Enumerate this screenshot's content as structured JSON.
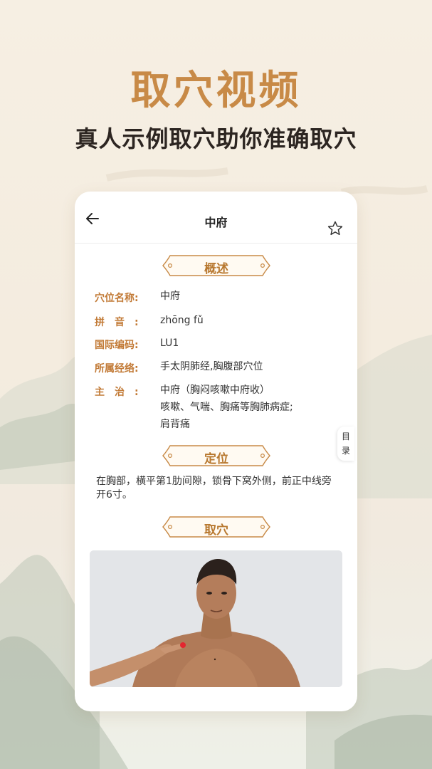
{
  "promo": {
    "title": "取穴视频",
    "subtitle": "真人示例取穴助你准确取穴"
  },
  "header": {
    "title": "中府",
    "back_icon": "arrow-left-icon",
    "favorite_icon": "star-outline-icon"
  },
  "sections": {
    "overview": "概述",
    "location": "定位",
    "acupoint": "取穴"
  },
  "overview": {
    "name_label": "穴位名称:",
    "name_value": "中府",
    "pinyin_label": "拼音:",
    "pinyin_value": "zhōng fǔ",
    "code_label": "国际编码:",
    "code_value": "LU1",
    "meridian_label": "所属经络:",
    "meridian_value": "手太阴肺经,胸腹部穴位",
    "indication_label": "主治:",
    "indication_lines": [
      "中府（胸闷咳嗽中府收）",
      "咳嗽、气喘、胸痛等胸肺病症;",
      "肩背痛"
    ]
  },
  "location_text": "在胸部，横平第1肋间隙，锁骨下窝外侧，前正中线旁开6寸。",
  "catalog_tab": "目录",
  "colors": {
    "accent": "#c88a47",
    "label": "#c27a36",
    "marker": "#e3262f"
  }
}
